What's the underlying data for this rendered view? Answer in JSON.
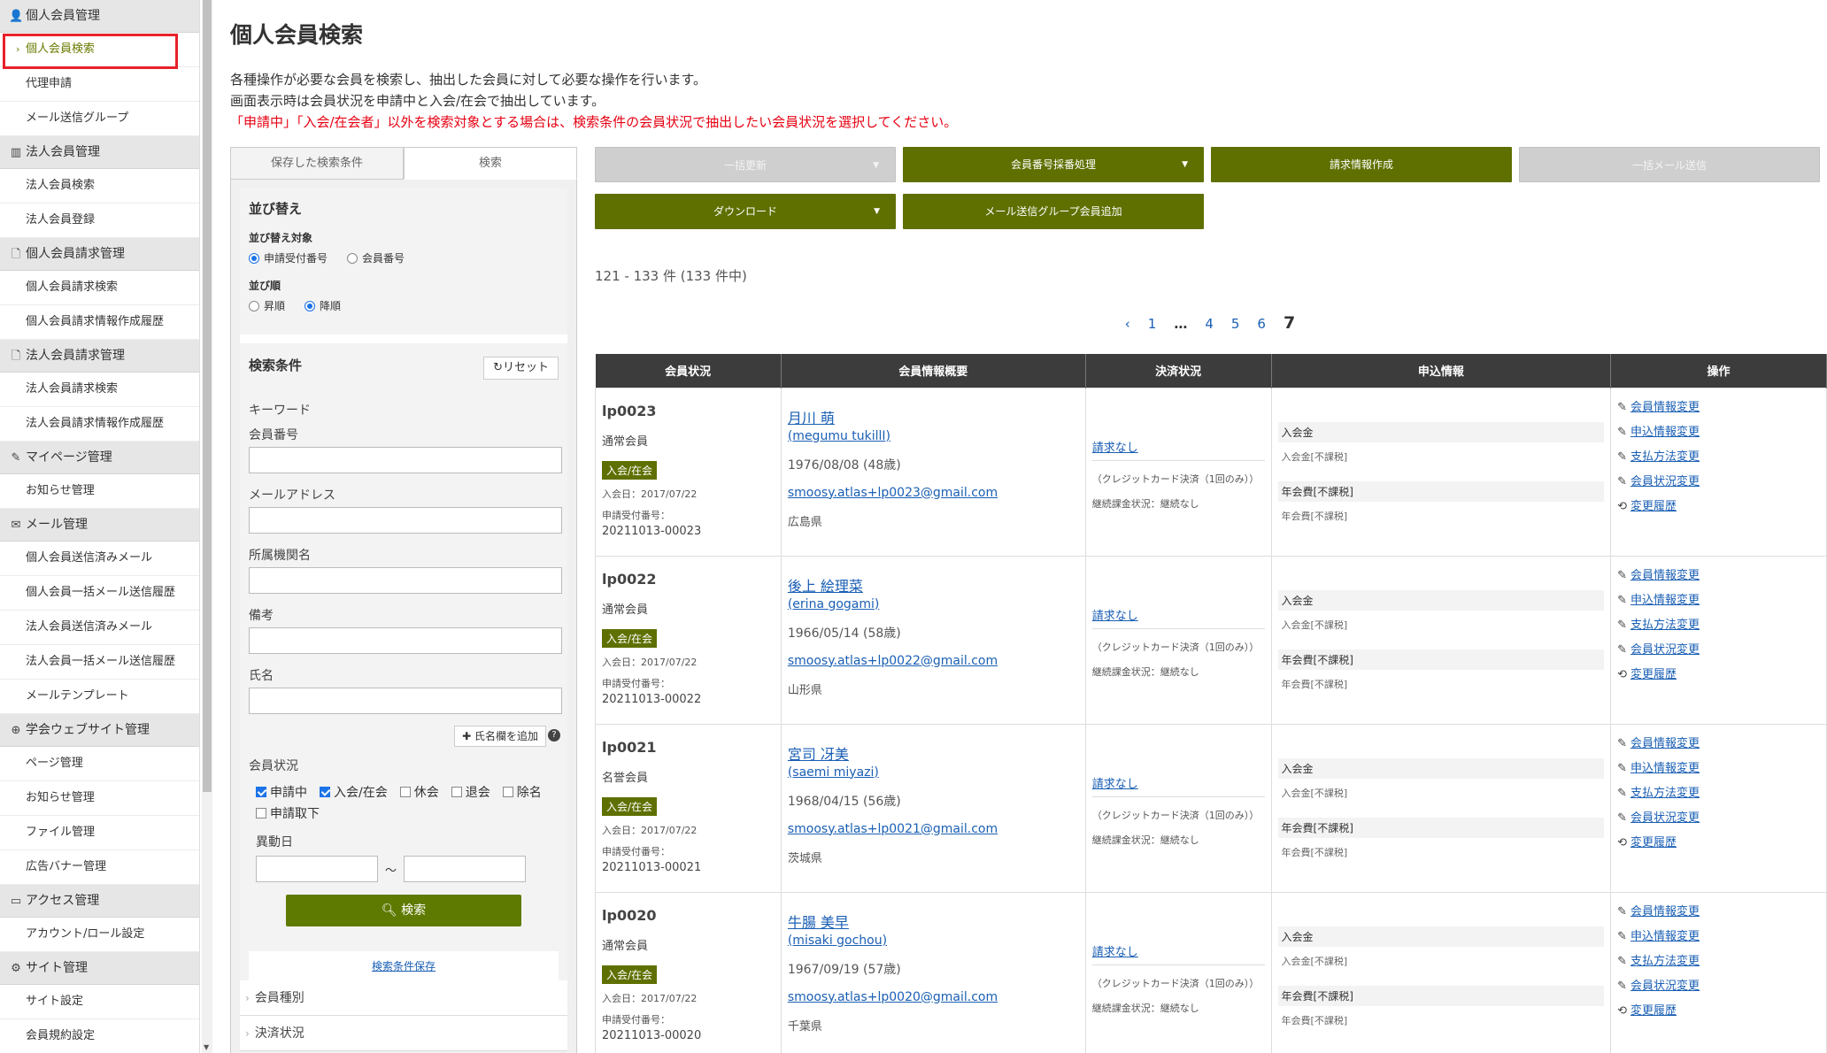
{
  "sidebar": {
    "sections": [
      {
        "label": "個人会員管理",
        "icon": "user-icon",
        "glyph": "👤",
        "items": [
          "個人会員検索",
          "代理申請",
          "メール送信グループ"
        ]
      },
      {
        "label": "法人会員管理",
        "icon": "building-icon",
        "glyph": "▥",
        "items": [
          "法人会員検索",
          "法人会員登録"
        ]
      },
      {
        "label": "個人会員請求管理",
        "icon": "file-icon",
        "glyph": "🗋",
        "items": [
          "個人会員請求検索",
          "個人会員請求情報作成履歴"
        ]
      },
      {
        "label": "法人会員請求管理",
        "icon": "file-icon",
        "glyph": "🗋",
        "items": [
          "法人会員請求検索",
          "法人会員請求情報作成履歴"
        ]
      },
      {
        "label": "マイページ管理",
        "icon": "pencil-icon",
        "glyph": "✎",
        "items": [
          "お知らせ管理"
        ]
      },
      {
        "label": "メール管理",
        "icon": "mail-icon",
        "glyph": "✉",
        "items": [
          "個人会員送信済みメール",
          "個人会員一括メール送信履歴",
          "法人会員送信済みメール",
          "法人会員一括メール送信履歴",
          "メールテンプレート"
        ]
      },
      {
        "label": "学会ウェブサイト管理",
        "icon": "globe-icon",
        "glyph": "⊕",
        "items": [
          "ページ管理",
          "お知らせ管理",
          "ファイル管理",
          "広告バナー管理"
        ]
      },
      {
        "label": "アクセス管理",
        "icon": "monitor-icon",
        "glyph": "▭",
        "items": [
          "アカウント/ロール設定"
        ]
      },
      {
        "label": "サイト管理",
        "icon": "gear-icon",
        "glyph": "⚙",
        "items": [
          "サイト設定",
          "会員規約設定"
        ]
      }
    ]
  },
  "page": {
    "title": "個人会員検索",
    "desc1": "各種操作が必要な会員を検索し、抽出した会員に対して必要な操作を行います。",
    "desc2": "画面表示時は会員状況を申請中と入会/在会で抽出しています。",
    "warning": "「申請中」「入会/在会者」以外を検索対象とする場合は、検索条件の会員状況で抽出したい会員状況を選択してください。"
  },
  "search": {
    "tab_saved": "保存した検索条件",
    "tab_search": "検索",
    "sort_title": "並び替え",
    "sort_target_label": "並び替え対象",
    "sort_target_opt1": "申請受付番号",
    "sort_target_opt2": "会員番号",
    "sort_order_label": "並び順",
    "sort_order_opt1": "昇順",
    "sort_order_opt2": "降順",
    "cond_title": "検索条件",
    "reset_label": "リセット",
    "keyword_label": "キーワード",
    "member_no_label": "会員番号",
    "email_label": "メールアドレス",
    "org_label": "所属機関名",
    "note_label": "備考",
    "name_label": "氏名",
    "add_name_label": "氏名欄を追加",
    "status_label": "会員状況",
    "status_opts": [
      {
        "label": "申請中",
        "checked": true
      },
      {
        "label": "入会/在会",
        "checked": true
      },
      {
        "label": "休会",
        "checked": false
      },
      {
        "label": "退会",
        "checked": false
      },
      {
        "label": "除名",
        "checked": false
      },
      {
        "label": "申請取下",
        "checked": false
      }
    ],
    "change_date_label": "異動日",
    "tilde": "～",
    "search_btn": "検索",
    "save_link": "検索条件保存",
    "acc1": "会員種別",
    "acc2": "決済状況"
  },
  "actions": {
    "bulk_update": "一括更新",
    "assign_no": "会員番号採番処理",
    "create_invoice": "請求情報作成",
    "bulk_mail": "一括メール送信",
    "download": "ダウンロード",
    "add_group": "メール送信グループ会員追加"
  },
  "results": {
    "count": "121 - 133 件 (133 件中)",
    "pager": {
      "prev": "‹",
      "pages": [
        "1",
        "4",
        "5",
        "6"
      ],
      "dots": "…",
      "current": "7"
    },
    "headers": [
      "会員状況",
      "会員情報概要",
      "決済状況",
      "申込情報",
      "操作"
    ],
    "rows": [
      {
        "id": "lp0023",
        "type": "通常会員",
        "badge": "入会/在会",
        "joined": "入会日：2017/07/22",
        "recv_label": "申請受付番号：",
        "recv_no": "20211013-00023",
        "name": "月川 萌",
        "kana": "(megumu tukillI)",
        "birth": "1976/08/08 (48歳)",
        "email": "smoosy.atlas+lp0023@gmail.com",
        "pref": "広島県"
      },
      {
        "id": "lp0022",
        "type": "通常会員",
        "badge": "入会/在会",
        "joined": "入会日：2017/07/22",
        "recv_label": "申請受付番号：",
        "recv_no": "20211013-00022",
        "name": "後上 絵理菜",
        "kana": "(erina gogami)",
        "birth": "1966/05/14 (58歳)",
        "email": "smoosy.atlas+lp0022@gmail.com",
        "pref": "山形県"
      },
      {
        "id": "lp0021",
        "type": "名誉会員",
        "badge": "入会/在会",
        "joined": "入会日：2017/07/22",
        "recv_label": "申請受付番号：",
        "recv_no": "20211013-00021",
        "name": "宮司 冴美",
        "kana": "(saemi miyazi)",
        "birth": "1968/04/15 (56歳)",
        "email": "smoosy.atlas+lp0021@gmail.com",
        "pref": "茨城県"
      },
      {
        "id": "lp0020",
        "type": "通常会員",
        "badge": "入会/在会",
        "joined": "入会日：2017/07/22",
        "recv_label": "申請受付番号：",
        "recv_no": "20211013-00020",
        "name": "牛腸 美早",
        "kana": "(misaki gochou)",
        "birth": "1967/09/19 (57歳)",
        "email": "smoosy.atlas+lp0020@gmail.com",
        "pref": "千葉県"
      }
    ],
    "pay": {
      "link": "請求なし",
      "method": "（クレジットカード決済（1回のみ））",
      "cont": "継続課金状況：継続なし"
    },
    "apply": {
      "fee_label": "入会金",
      "fee_value": "入会金[不課税]",
      "annual_label": "年会費[不課税]",
      "annual_value": "年会費[不課税]"
    },
    "ops": [
      "会員情報変更",
      "申込情報変更",
      "支払方法変更",
      "会員状況変更",
      "変更履歴"
    ]
  },
  "colors": {
    "olive": "#5f7000",
    "link": "#1a5fb4",
    "warn": "#e60012",
    "highlight": "#e8202a"
  }
}
